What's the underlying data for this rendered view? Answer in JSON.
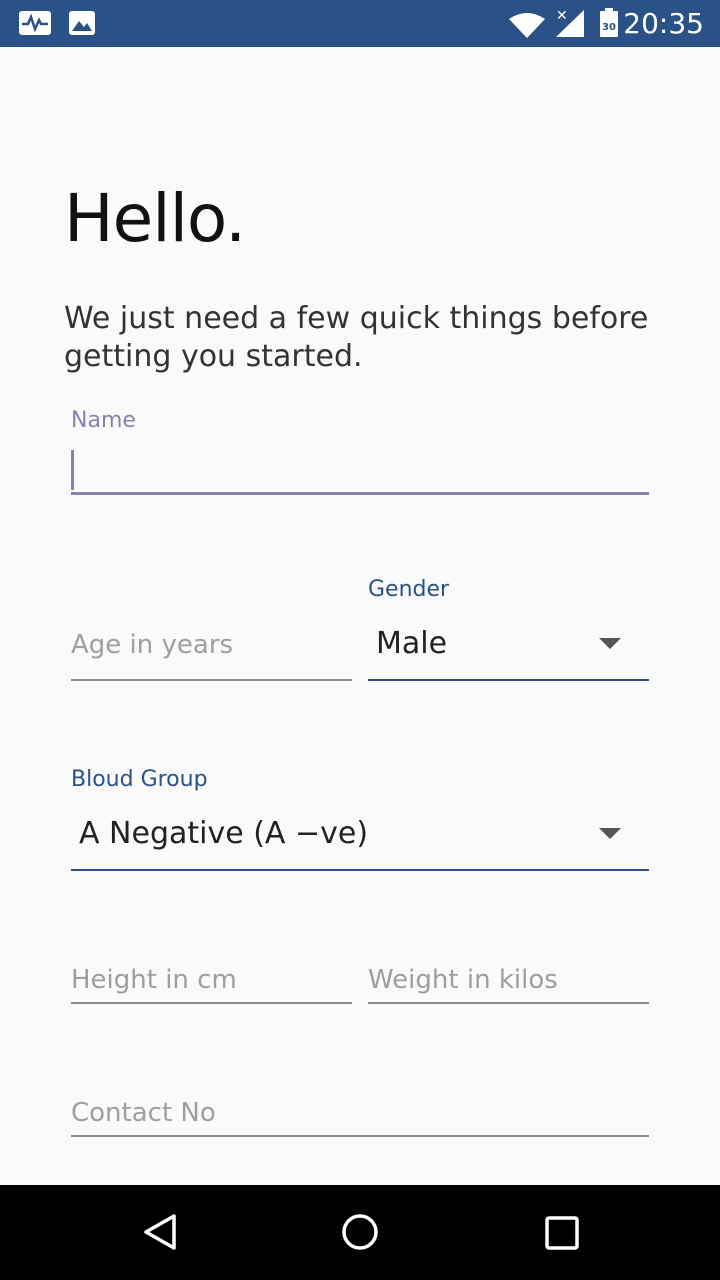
{
  "status_bar": {
    "time": "20:35",
    "battery_level": "30",
    "icons": [
      "pulse-icon",
      "image-icon",
      "wifi-icon",
      "signal-icon",
      "battery-icon"
    ]
  },
  "header": {
    "title": "Hello.",
    "subtitle": "We just need a few quick things before getting you started."
  },
  "form": {
    "name": {
      "label": "Name",
      "value": ""
    },
    "age": {
      "placeholder": "Age in years"
    },
    "gender": {
      "label": "Gender",
      "value": "Male"
    },
    "blood_group": {
      "label": "Bloud Group",
      "value": "A Negative (A −ve)"
    },
    "height": {
      "placeholder": "Height in cm"
    },
    "weight": {
      "placeholder": "Weight in kilos"
    },
    "contact": {
      "placeholder": "Contact No"
    }
  },
  "colors": {
    "status_bar": "#2a5286",
    "focused_accent": "#8a7fb0",
    "label_accent": "#2a5286"
  },
  "nav_bar": {
    "icons": [
      "back-icon",
      "home-icon",
      "recents-icon"
    ]
  }
}
